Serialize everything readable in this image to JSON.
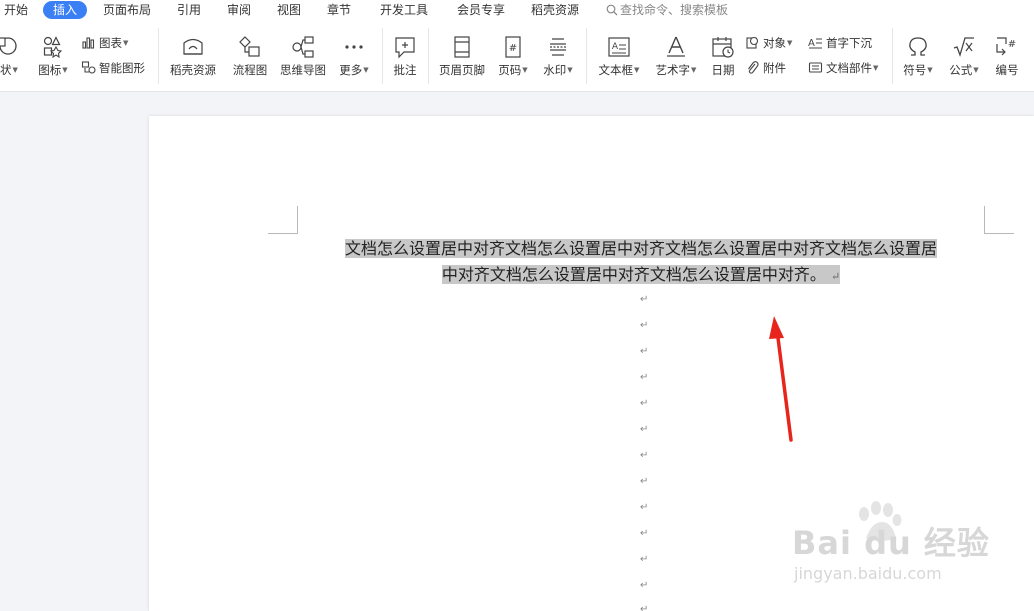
{
  "menu": {
    "items": [
      "开始",
      "插入",
      "页面布局",
      "引用",
      "审阅",
      "视图",
      "章节",
      "开发工具",
      "会员专享",
      "稻壳资源"
    ],
    "active_index": 1,
    "search_placeholder": "查找命令、搜索模板"
  },
  "ribbon": {
    "shape": "状",
    "icons": "图标",
    "chart": "图表",
    "smart_graphic": "智能图形",
    "docer_resource": "稻壳资源",
    "flowchart": "流程图",
    "mindmap": "思维导图",
    "more": "更多",
    "comment": "批注",
    "header_footer": "页眉页脚",
    "page_number": "页码",
    "watermark": "水印",
    "textbox": "文本框",
    "wordart": "艺术字",
    "date": "日期",
    "object": "对象",
    "attachment": "附件",
    "drop_cap": "首字下沉",
    "doc_parts": "文档部件",
    "symbol": "符号",
    "formula": "公式",
    "numbering": "编号"
  },
  "document": {
    "line1": "文档怎么设置居中对齐文档怎么设置居中对齐文档怎么设置居中对齐文档怎么设置居",
    "line2": "中对齐文档怎么设置居中对齐文档怎么设置居中对齐。",
    "paragraph_mark": "↵",
    "highlight_color": "#c8c8c8"
  },
  "annotation": {
    "arrow_color": "#e8251c"
  },
  "watermark": {
    "main": "Bai du 经验",
    "sub": "jingyan.baidu.com"
  },
  "colors": {
    "accent": "#3b7ff5"
  }
}
